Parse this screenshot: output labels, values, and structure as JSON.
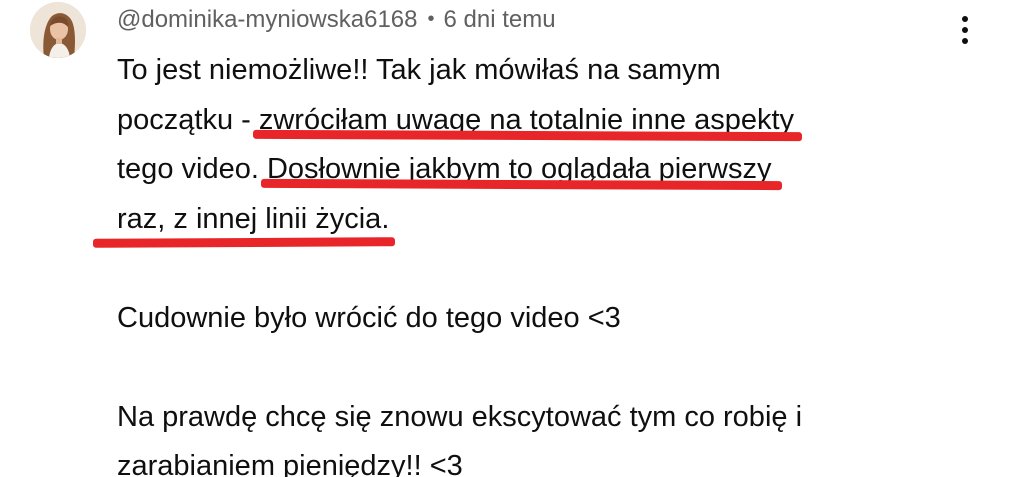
{
  "comment": {
    "author": "@dominika-myniowska6168",
    "separator": "•",
    "time": "6 dni temu",
    "avatar_icon": "user-avatar-photo",
    "menu_icon": "more-vertical-icon",
    "paragraphs": {
      "p1": {
        "line1": "To jest niemożliwe!! Tak jak mówiłaś na samym",
        "line2_plain": "początku - ",
        "line2_highlight": "zwróciłam uwagę na totalnie inne aspekty",
        "line3_plain": "tego video. ",
        "line3_highlight": "Dosłownie jakbym to oglądała pierwszy",
        "line4_highlight": "raz, z innej linii życia."
      },
      "p2": "Cudownie było wrócić do tego video <3",
      "p3_line1": "Na prawdę chcę się znowu ekscytować tym co robię i",
      "p3_line2": "zarabianiem pieniędzy!! <3"
    },
    "highlight_color": "#e8262a"
  }
}
